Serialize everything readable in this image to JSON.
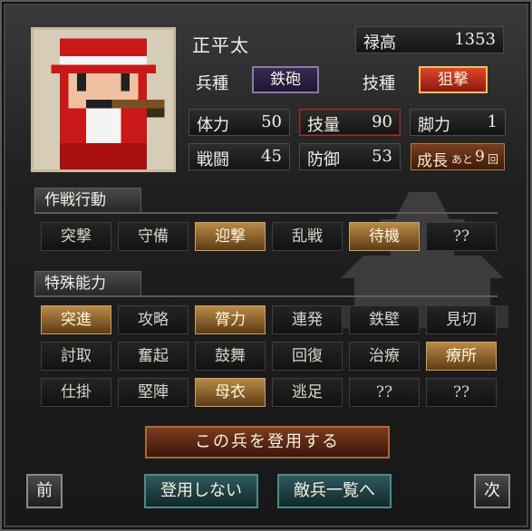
{
  "unit": {
    "name": "正平太",
    "salary_label": "禄高",
    "salary_value": "1353",
    "troop_label": "兵種",
    "troop_value": "鉄砲",
    "skill_type_label": "技種",
    "skill_type_value": "狙撃",
    "growth_label": "成長",
    "growth_remaining_prefix": "あと",
    "growth_value": "9",
    "growth_unit": "回"
  },
  "stats": [
    {
      "label": "体力",
      "value": "50"
    },
    {
      "label": "技量",
      "value": "90"
    },
    {
      "label": "脚力",
      "value": "1"
    },
    {
      "label": "戦闘",
      "value": "45"
    },
    {
      "label": "防御",
      "value": "53"
    }
  ],
  "tactics_section": {
    "title": "作戦行動",
    "items": [
      {
        "label": "突撃",
        "active": false
      },
      {
        "label": "守備",
        "active": false
      },
      {
        "label": "迎撃",
        "active": true
      },
      {
        "label": "乱戦",
        "active": false
      },
      {
        "label": "待機",
        "active": true
      },
      {
        "label": "??",
        "active": false
      }
    ]
  },
  "abilities_section": {
    "title": "特殊能力",
    "items": [
      {
        "label": "突進",
        "active": true
      },
      {
        "label": "攻略",
        "active": false
      },
      {
        "label": "膂力",
        "active": true
      },
      {
        "label": "連発",
        "active": false
      },
      {
        "label": "鉄壁",
        "active": false
      },
      {
        "label": "見切",
        "active": false
      },
      {
        "label": "討取",
        "active": false
      },
      {
        "label": "奮起",
        "active": false
      },
      {
        "label": "鼓舞",
        "active": false
      },
      {
        "label": "回復",
        "active": false
      },
      {
        "label": "治療",
        "active": false
      },
      {
        "label": "療所",
        "active": true
      },
      {
        "label": "仕掛",
        "active": false
      },
      {
        "label": "堅陣",
        "active": false
      },
      {
        "label": "母衣",
        "active": true
      },
      {
        "label": "逃足",
        "active": false
      },
      {
        "label": "??",
        "active": false
      },
      {
        "label": "??",
        "active": false
      }
    ]
  },
  "buttons": {
    "recruit": "この兵を登用する",
    "decline": "登用しない",
    "enemy_list": "敵兵一覧へ",
    "prev": "前",
    "next": "次"
  },
  "colors": {
    "active_chip": "#b98a48",
    "recruit_button": "#7c3b1e",
    "teal_button": "#2e5a5e",
    "troop_badge": "#3b2a52",
    "skill_badge": "#e2442a"
  }
}
